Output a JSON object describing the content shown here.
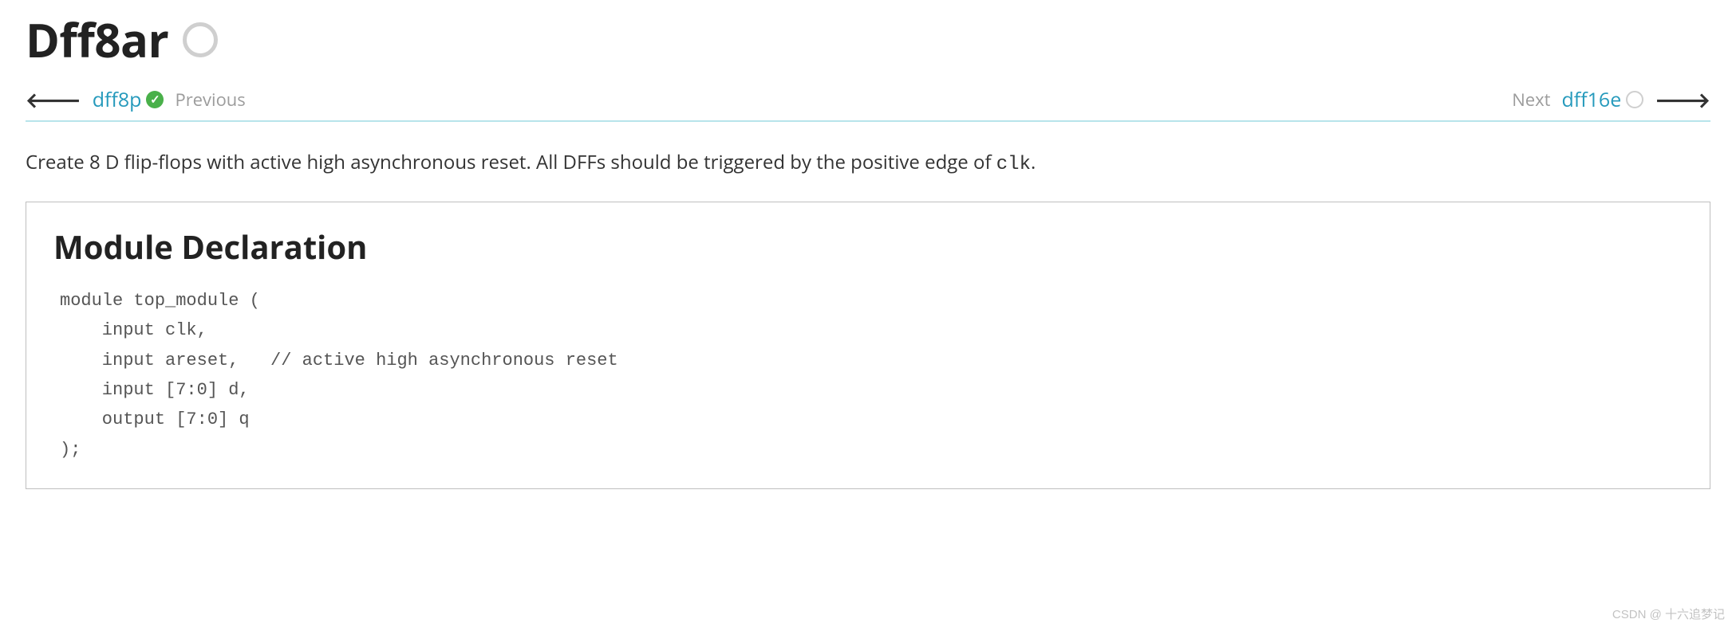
{
  "title": "Dff8ar",
  "nav": {
    "prev_link": "dff8p",
    "prev_label": "Previous",
    "next_label": "Next",
    "next_link": "dff16e"
  },
  "description": {
    "text_before_code": "Create 8 D flip-flops with active high asynchronous reset. All DFFs should be triggered by the positive edge of ",
    "code_word": "clk",
    "text_after_code": "."
  },
  "module": {
    "heading": "Module Declaration",
    "code": "module top_module (\n    input clk,\n    input areset,   // active high asynchronous reset\n    input [7:0] d,\n    output [7:0] q\n);"
  },
  "watermark": "CSDN @ 十六追梦记"
}
